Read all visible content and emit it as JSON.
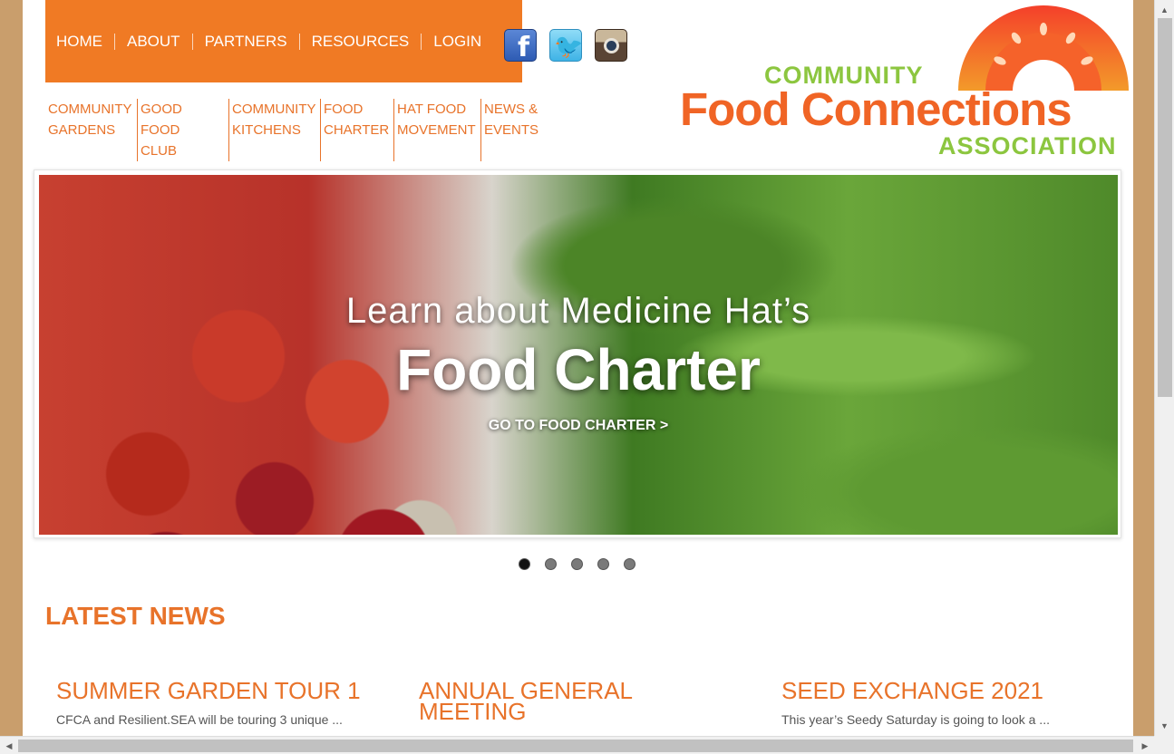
{
  "top_nav": [
    "HOME",
    "ABOUT",
    "PARTNERS",
    "RESOURCES",
    "LOGIN"
  ],
  "social": {
    "facebook": "facebook-icon",
    "twitter": "twitter-icon",
    "instagram": "instagram-icon"
  },
  "sub_nav": [
    "COMMUNITY\nGARDENS",
    "GOOD FOOD\nCLUB",
    "COMMUNITY\nKITCHENS",
    "FOOD\nCHARTER",
    "HAT FOOD\nMOVEMENT",
    "NEWS &\nEVENTS"
  ],
  "logo": {
    "line1": "COMMUNITY",
    "line2": "Food Connections",
    "line3": "ASSOCIATION"
  },
  "slider": {
    "heading": "Learn about Medicine Hat’s",
    "title": "Food Charter",
    "cta": "GO TO FOOD CHARTER >",
    "dots": 5,
    "active_dot": 0
  },
  "latest_news_heading": "LATEST NEWS",
  "news": [
    {
      "title": "SUMMER GARDEN TOUR 1",
      "excerpt": "CFCA and Resilient.SEA will be touring 3 unique ..."
    },
    {
      "title": "ANNUAL GENERAL\nMEETING",
      "excerpt": ""
    },
    {
      "title": "SEED EXCHANGE 2021",
      "excerpt": "This year’s Seedy Saturday is going to look a ..."
    }
  ],
  "colors": {
    "accent": "#f07a24",
    "brand_orange": "#f06425",
    "brand_green": "#8cc63f",
    "background": "#c99e6c"
  }
}
